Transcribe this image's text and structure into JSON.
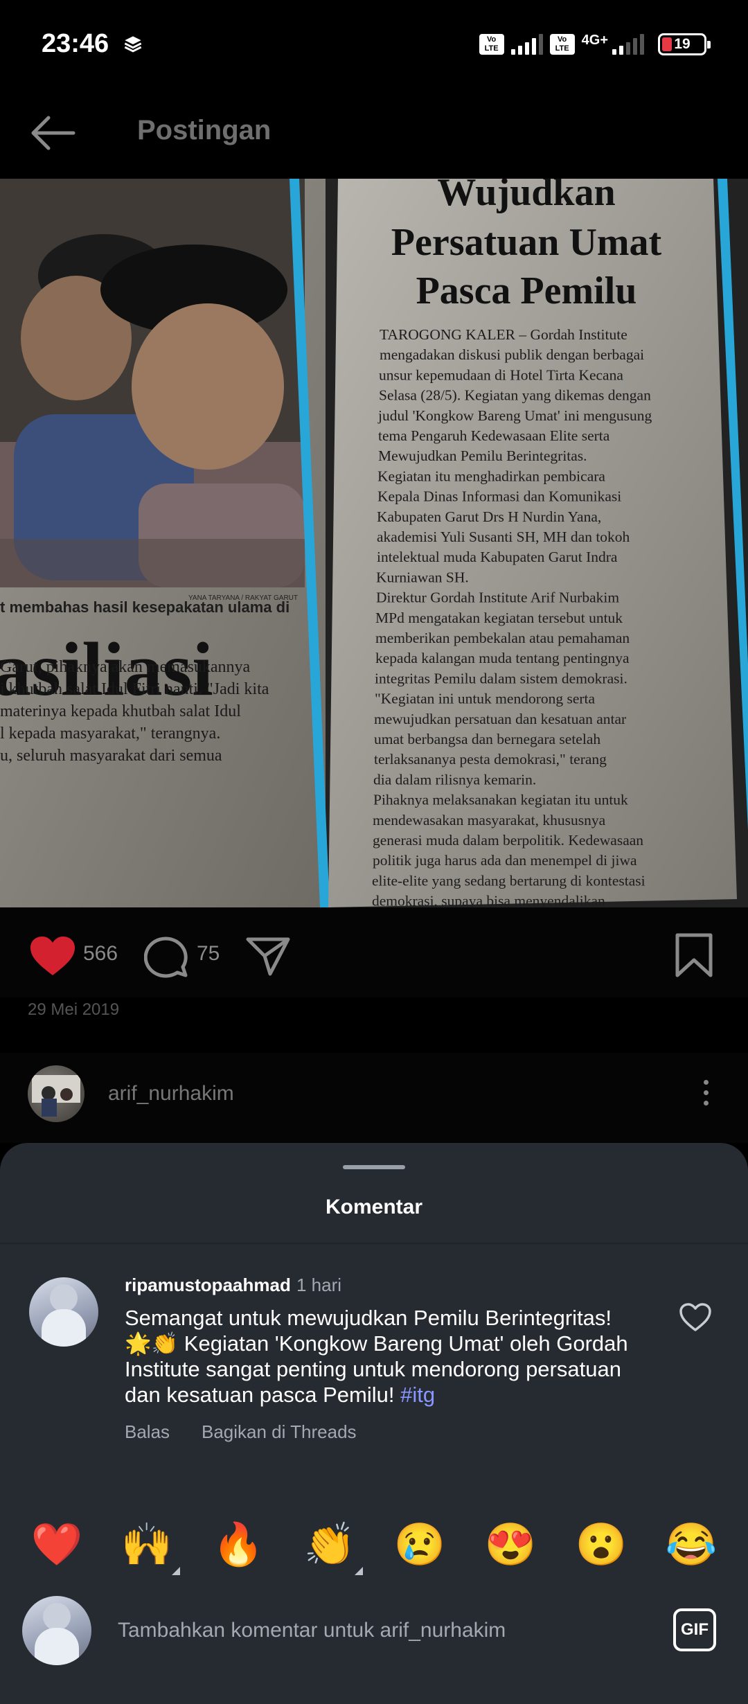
{
  "status_bar": {
    "time": "23:46",
    "sim1_badge": "Vo LTE",
    "sim2_badge": "Vo LTE",
    "network": "4G+",
    "battery": "19",
    "battery_color": "#e63946"
  },
  "header": {
    "title": "Postingan",
    "back_icon": "arrow-left-icon"
  },
  "post": {
    "image_content": {
      "headline": [
        "Wujudkan",
        "Persatuan Umat",
        "Pasca Pemilu"
      ],
      "photo_credit": "YANA TARYANA / RAKYAT GARUT",
      "caption": "t membahas hasil kesepakatan ulama di",
      "left_headline": "asiliasi",
      "left_column": [
        "Garut, pihaknya akan memasukannya",
        "i khutbah salat Idul Fitri nanti. \"Jadi kita",
        "materinya kepada khutbah salat Idul",
        "l kepada masyarakat,\" terangnya.",
        "u, seluruh masyarakat dari semua"
      ],
      "article_lines": [
        "TAROGONG KALER – Gordah Institute",
        "mengadakan diskusi publik dengan berbagai",
        "unsur kepemudaan di Hotel Tirta Kecana",
        "Selasa (28/5). Kegiatan yang dikemas dengan",
        "judul 'Kongkow Bareng Umat' ini mengusung",
        "tema Pengaruh Kedewasaan Elite serta",
        "Mewujudkan Pemilu Berintegritas.",
        "Kegiatan itu menghadirkan pembicara",
        "Kepala Dinas Informasi dan Komunikasi",
        "Kabupaten Garut Drs H Nurdin Yana,",
        "akademisi Yuli Susanti SH, MH dan tokoh",
        "intelektual muda Kabupaten Garut Indra",
        "Kurniawan SH.",
        "Direktur Gordah Institute Arif Nurbakim",
        "MPd mengatakan kegiatan tersebut untuk",
        "memberikan pembekalan atau pemahaman",
        "kepada kalangan muda tentang pentingnya",
        "integritas Pemilu dalam sistem demokrasi.",
        "\"Kegiatan ini untuk mendorong serta",
        "mewujudkan persatuan dan kesatuan antar",
        "umat berbangsa dan bernegara setelah",
        "terlaksananya pesta demokrasi,\" terang",
        "dia dalam rilisnya kemarin.",
        "Pihaknya melaksanakan kegiatan itu untuk",
        "mendewasakan masyarakat, khususnya",
        "generasi muda dalam berpolitik. Kedewasaan",
        "politik juga harus ada dan menempel di jiwa",
        "elite-elite yang sedang bertarung di kontestasi",
        "demokrasi, supaya bisa menyendalikan"
      ]
    },
    "likes": "566",
    "comments": "75",
    "date": "29 Mei 2019",
    "like_color": "#d3212f",
    "icons": [
      "heart-icon",
      "comment-icon",
      "send-icon",
      "bookmark-icon"
    ]
  },
  "author": {
    "username": "arif_nurhakim",
    "more_icon": "more-vertical-icon"
  },
  "comments_sheet": {
    "title": "Komentar",
    "comment": {
      "username": "ripamustopaahmad",
      "time": "1 hari",
      "text_line1": "Semangat untuk mewujudkan Pemilu Berintegritas!",
      "text_line2": "🌟👏 Kegiatan 'Kongkow Bareng Umat' oleh Gordah",
      "text_line3": "Institute sangat penting untuk mendorong persatuan",
      "text_line4": "dan kesatuan pasca Pemilu!",
      "hashtag": "#itg",
      "reply_label": "Balas",
      "threads_label": "Bagikan di Threads"
    },
    "quick_reactions": [
      "❤️",
      "🙌",
      "🔥",
      "👏",
      "😢",
      "😍",
      "😮",
      "😂"
    ],
    "input_placeholder": "Tambahkan komentar untuk arif_nurhakim",
    "gif_label": "GIF",
    "accent_color": "#8a97ff",
    "sheet_color": "#262a31"
  }
}
